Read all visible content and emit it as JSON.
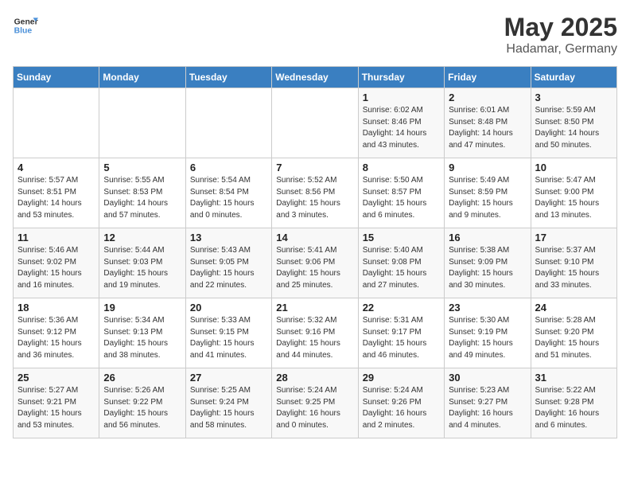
{
  "logo": {
    "line1": "General",
    "line2": "Blue"
  },
  "title": "May 2025",
  "subtitle": "Hadamar, Germany",
  "weekdays": [
    "Sunday",
    "Monday",
    "Tuesday",
    "Wednesday",
    "Thursday",
    "Friday",
    "Saturday"
  ],
  "weeks": [
    [
      {
        "day": "",
        "info": ""
      },
      {
        "day": "",
        "info": ""
      },
      {
        "day": "",
        "info": ""
      },
      {
        "day": "",
        "info": ""
      },
      {
        "day": "1",
        "info": "Sunrise: 6:02 AM\nSunset: 8:46 PM\nDaylight: 14 hours\nand 43 minutes."
      },
      {
        "day": "2",
        "info": "Sunrise: 6:01 AM\nSunset: 8:48 PM\nDaylight: 14 hours\nand 47 minutes."
      },
      {
        "day": "3",
        "info": "Sunrise: 5:59 AM\nSunset: 8:50 PM\nDaylight: 14 hours\nand 50 minutes."
      }
    ],
    [
      {
        "day": "4",
        "info": "Sunrise: 5:57 AM\nSunset: 8:51 PM\nDaylight: 14 hours\nand 53 minutes."
      },
      {
        "day": "5",
        "info": "Sunrise: 5:55 AM\nSunset: 8:53 PM\nDaylight: 14 hours\nand 57 minutes."
      },
      {
        "day": "6",
        "info": "Sunrise: 5:54 AM\nSunset: 8:54 PM\nDaylight: 15 hours\nand 0 minutes."
      },
      {
        "day": "7",
        "info": "Sunrise: 5:52 AM\nSunset: 8:56 PM\nDaylight: 15 hours\nand 3 minutes."
      },
      {
        "day": "8",
        "info": "Sunrise: 5:50 AM\nSunset: 8:57 PM\nDaylight: 15 hours\nand 6 minutes."
      },
      {
        "day": "9",
        "info": "Sunrise: 5:49 AM\nSunset: 8:59 PM\nDaylight: 15 hours\nand 9 minutes."
      },
      {
        "day": "10",
        "info": "Sunrise: 5:47 AM\nSunset: 9:00 PM\nDaylight: 15 hours\nand 13 minutes."
      }
    ],
    [
      {
        "day": "11",
        "info": "Sunrise: 5:46 AM\nSunset: 9:02 PM\nDaylight: 15 hours\nand 16 minutes."
      },
      {
        "day": "12",
        "info": "Sunrise: 5:44 AM\nSunset: 9:03 PM\nDaylight: 15 hours\nand 19 minutes."
      },
      {
        "day": "13",
        "info": "Sunrise: 5:43 AM\nSunset: 9:05 PM\nDaylight: 15 hours\nand 22 minutes."
      },
      {
        "day": "14",
        "info": "Sunrise: 5:41 AM\nSunset: 9:06 PM\nDaylight: 15 hours\nand 25 minutes."
      },
      {
        "day": "15",
        "info": "Sunrise: 5:40 AM\nSunset: 9:08 PM\nDaylight: 15 hours\nand 27 minutes."
      },
      {
        "day": "16",
        "info": "Sunrise: 5:38 AM\nSunset: 9:09 PM\nDaylight: 15 hours\nand 30 minutes."
      },
      {
        "day": "17",
        "info": "Sunrise: 5:37 AM\nSunset: 9:10 PM\nDaylight: 15 hours\nand 33 minutes."
      }
    ],
    [
      {
        "day": "18",
        "info": "Sunrise: 5:36 AM\nSunset: 9:12 PM\nDaylight: 15 hours\nand 36 minutes."
      },
      {
        "day": "19",
        "info": "Sunrise: 5:34 AM\nSunset: 9:13 PM\nDaylight: 15 hours\nand 38 minutes."
      },
      {
        "day": "20",
        "info": "Sunrise: 5:33 AM\nSunset: 9:15 PM\nDaylight: 15 hours\nand 41 minutes."
      },
      {
        "day": "21",
        "info": "Sunrise: 5:32 AM\nSunset: 9:16 PM\nDaylight: 15 hours\nand 44 minutes."
      },
      {
        "day": "22",
        "info": "Sunrise: 5:31 AM\nSunset: 9:17 PM\nDaylight: 15 hours\nand 46 minutes."
      },
      {
        "day": "23",
        "info": "Sunrise: 5:30 AM\nSunset: 9:19 PM\nDaylight: 15 hours\nand 49 minutes."
      },
      {
        "day": "24",
        "info": "Sunrise: 5:28 AM\nSunset: 9:20 PM\nDaylight: 15 hours\nand 51 minutes."
      }
    ],
    [
      {
        "day": "25",
        "info": "Sunrise: 5:27 AM\nSunset: 9:21 PM\nDaylight: 15 hours\nand 53 minutes."
      },
      {
        "day": "26",
        "info": "Sunrise: 5:26 AM\nSunset: 9:22 PM\nDaylight: 15 hours\nand 56 minutes."
      },
      {
        "day": "27",
        "info": "Sunrise: 5:25 AM\nSunset: 9:24 PM\nDaylight: 15 hours\nand 58 minutes."
      },
      {
        "day": "28",
        "info": "Sunrise: 5:24 AM\nSunset: 9:25 PM\nDaylight: 16 hours\nand 0 minutes."
      },
      {
        "day": "29",
        "info": "Sunrise: 5:24 AM\nSunset: 9:26 PM\nDaylight: 16 hours\nand 2 minutes."
      },
      {
        "day": "30",
        "info": "Sunrise: 5:23 AM\nSunset: 9:27 PM\nDaylight: 16 hours\nand 4 minutes."
      },
      {
        "day": "31",
        "info": "Sunrise: 5:22 AM\nSunset: 9:28 PM\nDaylight: 16 hours\nand 6 minutes."
      }
    ]
  ]
}
